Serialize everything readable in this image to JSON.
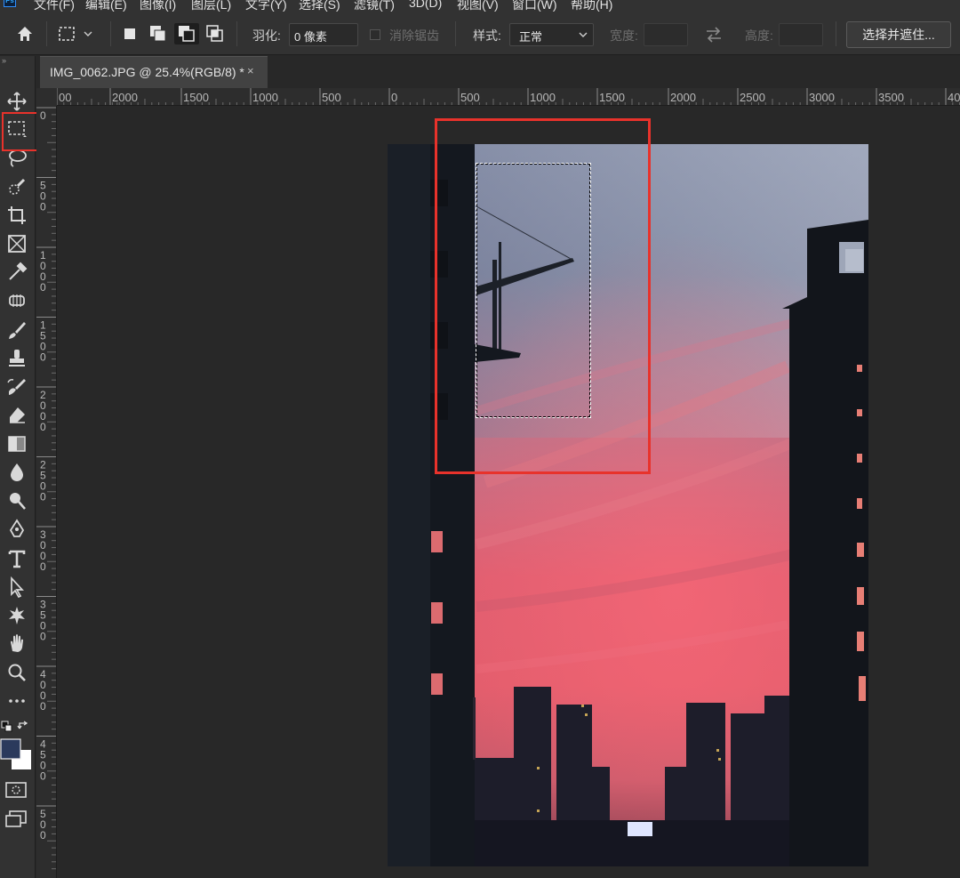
{
  "app": {
    "logo": "Ps"
  },
  "menu": [
    "文件(F)",
    "编辑(E)",
    "图像(I)",
    "图层(L)",
    "文字(Y)",
    "选择(S)",
    "滤镜(T)",
    "3D(D)",
    "视图(V)",
    "窗口(W)",
    "帮助(H)"
  ],
  "options": {
    "feather_label": "羽化:",
    "feather_value": "0 像素",
    "antialias_label": "消除锯齿",
    "style_label": "样式:",
    "style_value": "正常",
    "width_label": "宽度:",
    "height_label": "高度:",
    "select_mask_button": "选择并遮住..."
  },
  "document": {
    "tab_title": "IMG_0062.JPG @ 25.4%(RGB/8) *",
    "close_glyph": "×"
  },
  "ruler_top_labels": [
    "00",
    "2000",
    "1500",
    "1000",
    "500",
    "0",
    "500",
    "1000",
    "1500",
    "2000",
    "2500",
    "3000",
    "3500",
    "40"
  ],
  "ruler_left_labels": [
    "0",
    "5\n0\n0",
    "1\n0\n0\n0",
    "1\n5\n0\n0",
    "2\n0\n0\n0",
    "2\n5\n0\n0",
    "3\n0\n0\n0",
    "3\n5\n0\n0",
    "4\n0\n0\n0",
    "4\n5\n0\n0",
    "5\n0\n0"
  ],
  "colors": {
    "accent_highlight": "#e8322b",
    "foreground_color": "#2b3a5c",
    "background_color": "#ffffff"
  },
  "tools": [
    "move-tool",
    "rectangular-marquee-tool",
    "lasso-tool",
    "quick-selection-tool",
    "crop-tool",
    "frame-tool",
    "eyedropper-tool",
    "spot-healing-tool",
    "brush-tool",
    "clone-stamp-tool",
    "history-brush-tool",
    "eraser-tool",
    "gradient-tool",
    "blur-tool",
    "dodge-tool",
    "pen-tool",
    "type-tool",
    "path-selection-tool",
    "custom-shape-tool",
    "hand-tool",
    "zoom-tool",
    "more-tools"
  ]
}
